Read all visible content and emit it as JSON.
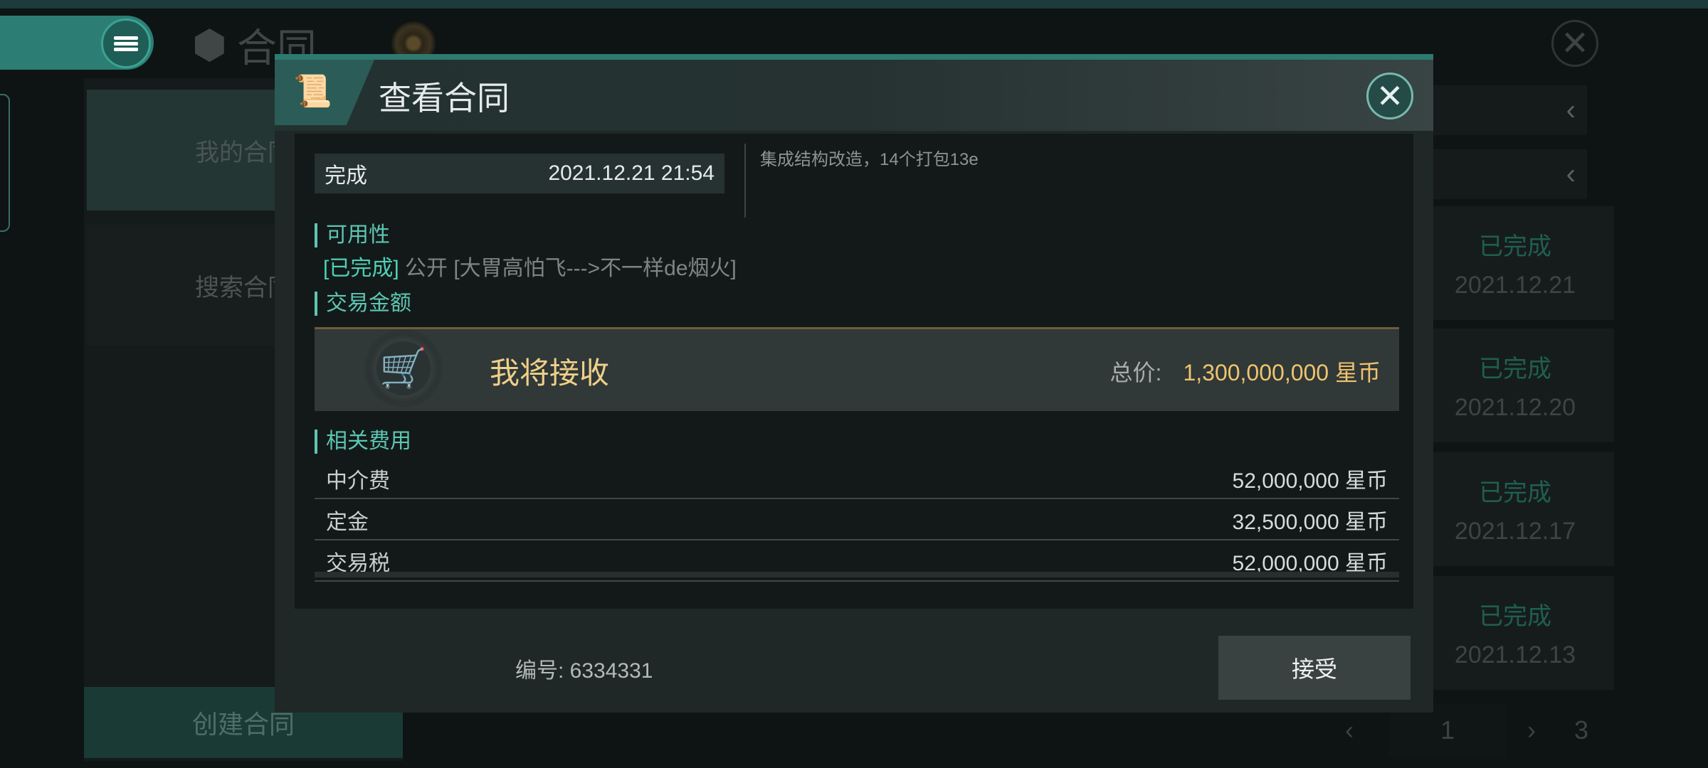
{
  "header": {
    "page_title": "合同"
  },
  "sidebar": {
    "items": [
      {
        "label": "我的合同"
      },
      {
        "label": "搜索合同"
      }
    ],
    "create_label": "创建合同"
  },
  "list": {
    "rows": [
      {
        "status": "已完成",
        "date": "2021.12.21"
      },
      {
        "status": "已完成",
        "date": "2021.12.20"
      },
      {
        "status": "已完成",
        "date": "2021.12.17"
      },
      {
        "status": "已完成",
        "date": "2021.12.13"
      }
    ],
    "pager": {
      "current": "1",
      "total": "3"
    }
  },
  "modal": {
    "title": "查看合同",
    "status": "完成",
    "datetime": "2021.12.21 21:54",
    "note": "集成结构改造，14个打包13e",
    "availability_label": "可用性",
    "availability_status": "[已完成]",
    "availability_text": "公开 [大胃高怕飞--->不一样de烟火]",
    "amount_label": "交易金额",
    "receive_label": "我将接收",
    "total_label": "总价:",
    "total_value": "1,300,000,000 星币",
    "fees_label": "相关费用",
    "fees": [
      {
        "name": "中介费",
        "value": "52,000,000 星币"
      },
      {
        "name": "定金",
        "value": "32,500,000 星币"
      },
      {
        "name": "交易税",
        "value": "52,000,000 星币"
      }
    ],
    "contract_id": "编号: 6334331",
    "accept_label": "接受"
  },
  "colors": {
    "accent": "#5dc6b3",
    "gold": "#f0c46d",
    "status_done": "#4fd0b6"
  },
  "icons": [
    "menu-icon",
    "cube-icon",
    "close-icon",
    "scroll-icon",
    "cart-download-icon",
    "chevron-left-icon",
    "chevron-right-icon"
  ]
}
